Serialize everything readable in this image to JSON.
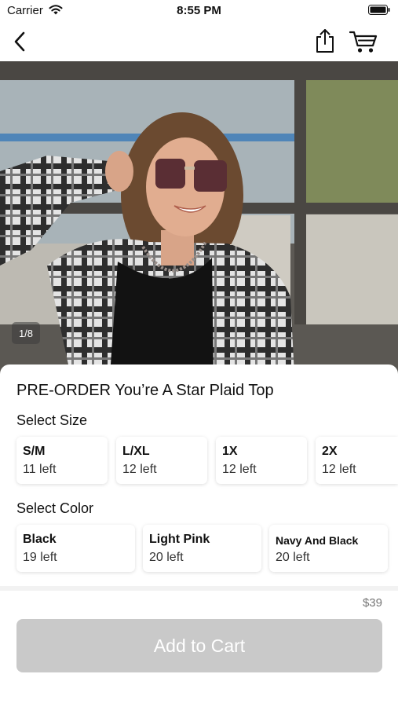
{
  "status_bar": {
    "carrier": "Carrier",
    "time": "8:55 PM"
  },
  "image": {
    "counter": "1/8"
  },
  "product": {
    "title": "PRE-ORDER You’re A Star Plaid Top",
    "price": "$39"
  },
  "size": {
    "label": "Select Size",
    "options": [
      {
        "name": "S/M",
        "stock": "11 left"
      },
      {
        "name": "L/XL",
        "stock": "12 left"
      },
      {
        "name": "1X",
        "stock": "12 left"
      },
      {
        "name": "2X",
        "stock": "12 left"
      }
    ]
  },
  "color": {
    "label": "Select Color",
    "options": [
      {
        "name": "Black",
        "stock": "19 left"
      },
      {
        "name": "Light Pink",
        "stock": "20 left"
      },
      {
        "name": "Navy And Black",
        "stock": "20 left"
      }
    ]
  },
  "cta": {
    "label": "Add to Cart"
  },
  "icons": {
    "back": "chevron-left-icon",
    "share": "share-icon",
    "cart": "cart-icon",
    "wifi": "wifi-icon",
    "battery": "battery-icon"
  }
}
